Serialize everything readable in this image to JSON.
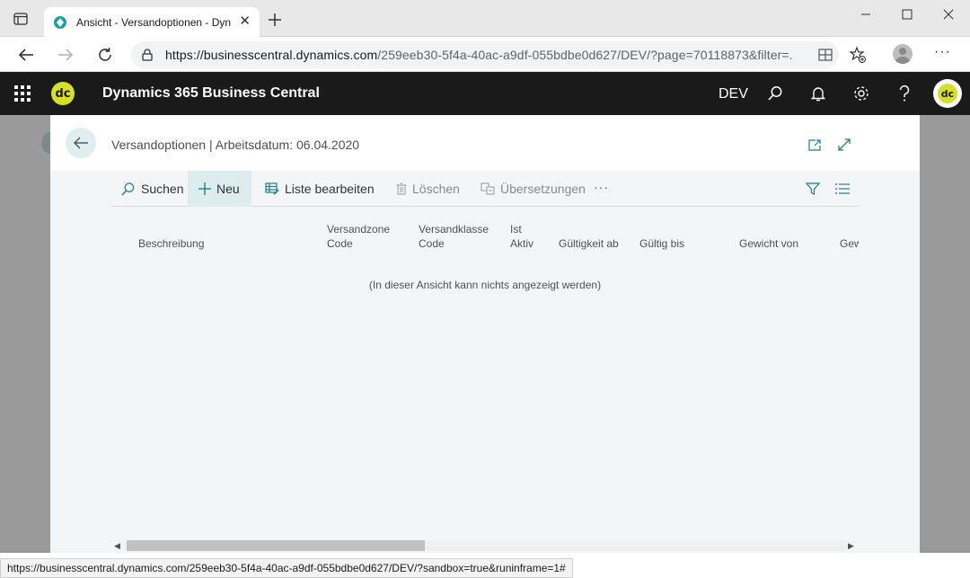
{
  "browser": {
    "tab_title": "Ansicht - Versandoptionen - Dyn",
    "url_host": "https://businesscentral.dynamics.com",
    "url_path": "/259eeb30-5f4a-40ac-a9df-055bdbe0d627/DEV/?page=70118873&filter=...",
    "status_url": "https://businesscentral.dynamics.com/259eeb30-5f4a-40ac-a9df-055bdbe0d627/DEV/?sandbox=true&runinframe=1#",
    "more_label": "···"
  },
  "app": {
    "logo_text": "dc",
    "title": "Dynamics 365 Business Central",
    "environment": "DEV",
    "accent_color": "#d6e024",
    "bar_color": "#1a1a1a"
  },
  "page": {
    "title": "Versandoptionen | Arbeitsdatum: 06.04.2020",
    "actions": {
      "search": "Suchen",
      "new": "Neu",
      "edit_list": "Liste bearbeiten",
      "delete": "Löschen",
      "translations": "Übersetzungen",
      "more": "···"
    },
    "columns": [
      {
        "line1": "",
        "line2": "Beschreibung"
      },
      {
        "line1": "Versandzone",
        "line2": "Code"
      },
      {
        "line1": "Versandklasse",
        "line2": "Code"
      },
      {
        "line1": "Ist",
        "line2": "Aktiv"
      },
      {
        "line1": "",
        "line2": "Gültigkeit ab"
      },
      {
        "line1": "",
        "line2": "Gültig bis"
      },
      {
        "line1": "",
        "line2": "Gewicht von"
      },
      {
        "line1": "",
        "line2": "Gew"
      }
    ],
    "empty_message": "(In dieser Ansicht kann nichts angezeigt werden)"
  }
}
